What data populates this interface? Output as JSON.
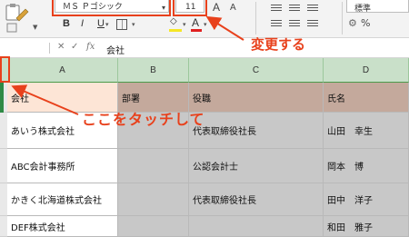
{
  "ribbon": {
    "font_name": "ＭＳ Ｐゴシック",
    "font_size": "11",
    "grow_label": "A",
    "shrink_label": "A",
    "bold_label": "B",
    "italic_label": "I",
    "underline_label": "U",
    "font_color_label": "A",
    "style_value": "標準",
    "percent_label": "%",
    "colors": {
      "fill": "#f5e626",
      "font": "#e02020"
    }
  },
  "formula_bar": {
    "fx_label": "fx",
    "value": "会社"
  },
  "columns": [
    "A",
    "B",
    "C",
    "D"
  ],
  "table": {
    "headers": [
      "会社",
      "部署",
      "役職",
      "氏名"
    ],
    "rows": [
      [
        "あいう株式会社",
        "",
        "代表取締役社長",
        "山田　幸生"
      ],
      [
        "ABC会計事務所",
        "",
        "公認会計士",
        "岡本　博"
      ],
      [
        "かきく北海道株式会社",
        "",
        "代表取締役社長",
        "田中　洋子"
      ],
      [
        "DEF株式会社",
        "",
        "",
        "和田　雅子"
      ]
    ]
  },
  "annotations": {
    "change_label": "変更する",
    "touch_label": "ここをタッチして",
    "color": "#e8411c"
  }
}
